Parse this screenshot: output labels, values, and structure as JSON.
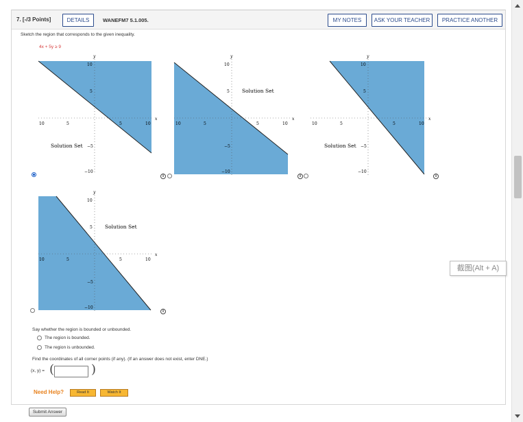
{
  "header": {
    "question_number": "7.",
    "points": "[-/3 Points]",
    "details_label": "DETAILS",
    "question_code": "WANEFM7 5.1.005.",
    "my_notes_label": "MY NOTES",
    "ask_teacher_label": "ASK YOUR TEACHER",
    "practice_another_label": "PRACTICE ANOTHER"
  },
  "prompt": "Sketch the region that corresponds to the given inequality.",
  "inequality": "4x + 5y ≥ 9",
  "graph_labels": {
    "x_axis": "x",
    "y_axis": "y",
    "tick_10": "10",
    "tick_5": "5",
    "tick_neg5": "−5",
    "tick_neg10": "−10",
    "solution_set": "Solution Set"
  },
  "graphs": [
    {
      "option": 1,
      "selected": true,
      "label_quadrant": "lower-left",
      "shaded": "above"
    },
    {
      "option": 2,
      "selected": false,
      "label_quadrant": "upper-right",
      "shaded": "below"
    },
    {
      "option": 3,
      "selected": false,
      "label_quadrant": "lower-left",
      "shaded": "above"
    },
    {
      "option": 4,
      "selected": false,
      "label_quadrant": "upper-right",
      "shaded": "below"
    }
  ],
  "bounded_question": "Say whether the region is bounded or unbounded.",
  "bounded_options": [
    "The region is bounded.",
    "The region is unbounded."
  ],
  "corner_question": "Find the coordinates of all corner points (if any). (If an answer does not exist, enter DNE.)",
  "answer_label": "(x, y) =",
  "answer_value": "",
  "help": {
    "need_help": "Need Help?",
    "read_it": "Read It",
    "watch_it": "Watch It"
  },
  "submit_label": "Submit Answer",
  "screenshot_tip": "截图(Alt + A)",
  "colors": {
    "shade": "#6aaad6",
    "accent": "#2a4a8c",
    "inequality": "#d63b3b",
    "need_help": "#e8821e",
    "help_button": "#f7b733"
  }
}
